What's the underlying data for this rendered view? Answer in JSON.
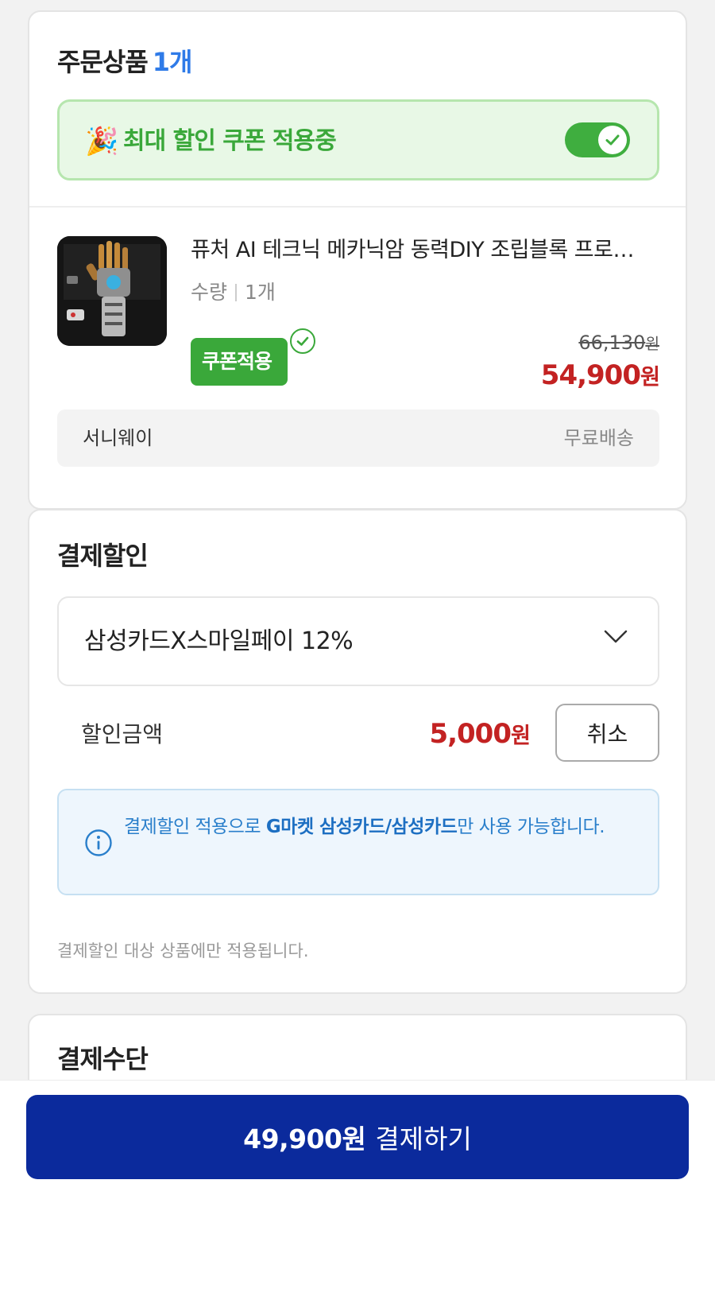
{
  "order": {
    "title": "주문상품",
    "count": "1개",
    "coupon_banner": {
      "label": "최대 할인 쿠폰 적용중",
      "toggle_on": true
    },
    "item": {
      "name": "퓨처 AI 테크닉 메카닉암 동력DIY 조립블록 프로…",
      "qty_label": "수량",
      "qty_value": "1개",
      "coupon_tag": "쿠폰적용",
      "original_price": "66,130",
      "sale_price": "54,900",
      "currency": "원"
    },
    "seller": "서니웨이",
    "shipping": "무료배송"
  },
  "discount": {
    "title": "결제할인",
    "selected_option": "삼성카드X스마일페이 12%",
    "amount_label": "할인금액",
    "amount": "5,000",
    "currency": "원",
    "cancel_label": "취소",
    "info_prefix": "결제할인 적용으로 ",
    "info_bold": "G마켓 삼성카드/삼성카드",
    "info_suffix": "만 사용 가능합니다.",
    "footnote": "결제할인 대상 상품에만 적용됩니다."
  },
  "payment_method": {
    "title": "결제수단"
  },
  "pay_button": {
    "amount": "49,900원",
    "label": "결제하기"
  },
  "colors": {
    "accent_blue": "#2f7be8",
    "coupon_green": "#3aa83a",
    "price_red": "#c32222",
    "pay_navy": "#0b2a9c"
  }
}
